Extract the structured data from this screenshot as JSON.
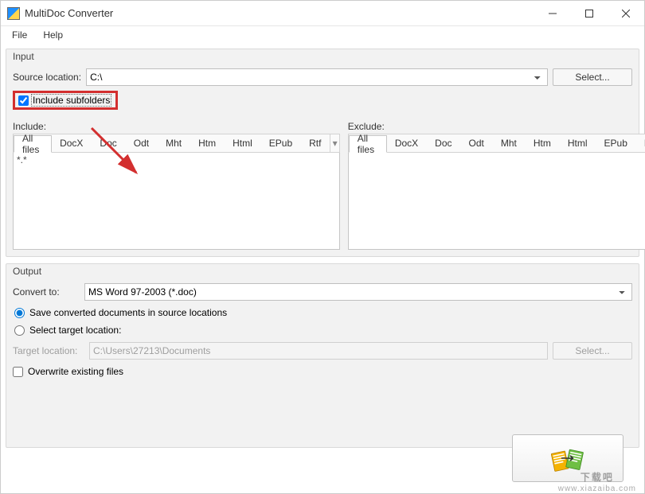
{
  "window": {
    "title": "MultiDoc Converter"
  },
  "menu": {
    "file": "File",
    "help": "Help"
  },
  "input": {
    "legend": "Input",
    "source_label": "Source location:",
    "source_value": "C:\\",
    "select_btn": "Select...",
    "include_subfolders_label": "Include subfolders",
    "include_subfolders_checked": true,
    "include_label": "Include:",
    "exclude_label": "Exclude:",
    "tabs": {
      "all": "All files",
      "docx": "DocX",
      "doc": "Doc",
      "odt": "Odt",
      "mht": "Mht",
      "htm": "Htm",
      "html": "Html",
      "epub": "EPub",
      "rtf": "Rtf"
    },
    "tab_scroll_glyph": "▾",
    "include_list_text": "*.*",
    "exclude_list_text": ""
  },
  "output": {
    "legend": "Output",
    "convert_label": "Convert to:",
    "convert_value": "MS Word 97-2003 (*.doc)",
    "save_in_source_label": "Save converted documents in source locations",
    "select_target_label": "Select target location:",
    "save_in_source_selected": true,
    "target_label": "Target location:",
    "target_value": "C:\\Users\\27213\\Documents",
    "target_select_btn": "Select...",
    "overwrite_label": "Overwrite existing files",
    "overwrite_checked": false
  },
  "watermark": {
    "text": "下载吧",
    "url": "www.xiazaiba.com"
  }
}
